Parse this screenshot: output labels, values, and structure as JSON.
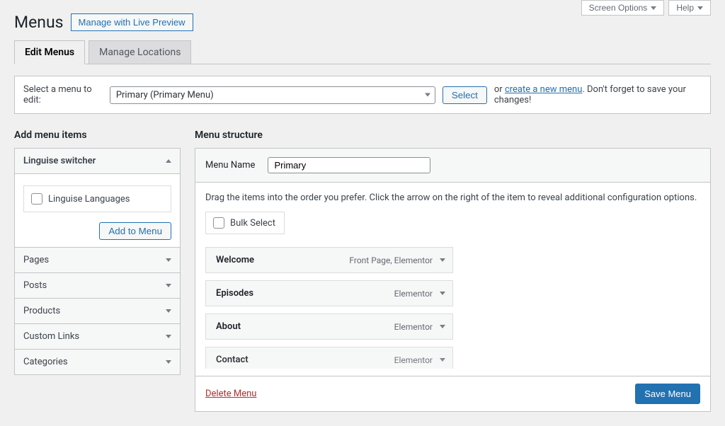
{
  "topbar": {
    "screen_options": "Screen Options",
    "help": "Help"
  },
  "heading": {
    "title": "Menus",
    "live_preview": "Manage with Live Preview"
  },
  "tabs": {
    "edit": "Edit Menus",
    "locations": "Manage Locations"
  },
  "selectbar": {
    "label": "Select a menu to edit:",
    "selected": "Primary (Primary Menu)",
    "select_btn": "Select",
    "or": "or",
    "create_link": "create a new menu",
    "tail": ". Don't forget to save your changes!"
  },
  "left": {
    "heading": "Add menu items",
    "linguise_title": "Linguise switcher",
    "linguise_checkbox": "Linguise Languages",
    "add_to_menu": "Add to Menu",
    "accordion": {
      "pages": "Pages",
      "posts": "Posts",
      "products": "Products",
      "custom_links": "Custom Links",
      "categories": "Categories"
    }
  },
  "right": {
    "heading": "Menu structure",
    "name_label": "Menu Name",
    "name_value": "Primary",
    "instructions": "Drag the items into the order you prefer. Click the arrow on the right of the item to reveal additional configuration options.",
    "bulk_select": "Bulk Select",
    "items": [
      {
        "title": "Welcome",
        "type": "Front Page, Elementor"
      },
      {
        "title": "Episodes",
        "type": "Elementor"
      },
      {
        "title": "About",
        "type": "Elementor"
      },
      {
        "title": "Contact",
        "type": "Elementor"
      }
    ],
    "delete": "Delete Menu",
    "save": "Save Menu"
  }
}
